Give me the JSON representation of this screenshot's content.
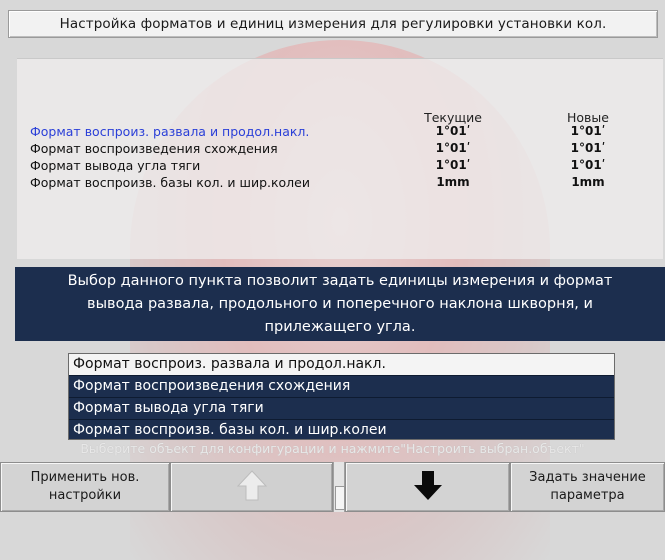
{
  "title": "Настройка форматов и единиц измерения для регулировки установки кол.",
  "table": {
    "col_current": "Текущие",
    "col_new": "Новые",
    "rows": [
      {
        "label": "Формат воспроиз. развала и продол.накл.",
        "current": "1°01ʹ",
        "new": "1°01ʹ",
        "selected": true
      },
      {
        "label": "Формат воспроизведения схождения",
        "current": "1°01ʹ",
        "new": "1°01ʹ"
      },
      {
        "label": "Формат вывода угла тяги",
        "current": "1°01ʹ",
        "new": "1°01ʹ"
      },
      {
        "label": "Формат воспроизв. базы кол. и шир.колеи",
        "current": "1mm",
        "new": "1mm"
      }
    ]
  },
  "description": {
    "line1": "Выбор данного пункта позволит задать единицы измерения и формат",
    "line2": "вывода развала, продольного и поперечного наклона шкворня, и",
    "line3": "прилежащего угла."
  },
  "list": {
    "items": [
      "Формат воспроиз. развала и продол.накл.",
      "Формат воспроизведения схождения",
      "Формат вывода угла тяги",
      "Формат воспроизв. базы кол. и шир.колеи"
    ],
    "selected_index": 0
  },
  "hint": "Выберите объект для конфигурации и нажмите\"Настроить выбран.объект\"",
  "buttons": {
    "apply_line1": "Применить нов.",
    "apply_line2": "настройки",
    "up_icon": "arrow-up-icon",
    "down_icon": "arrow-down-icon",
    "set_line1": "Задать значение",
    "set_line2": "параметра"
  },
  "colors": {
    "selected_row_text": "#2a3fd8",
    "panel_dark": "#1c2e4e"
  }
}
